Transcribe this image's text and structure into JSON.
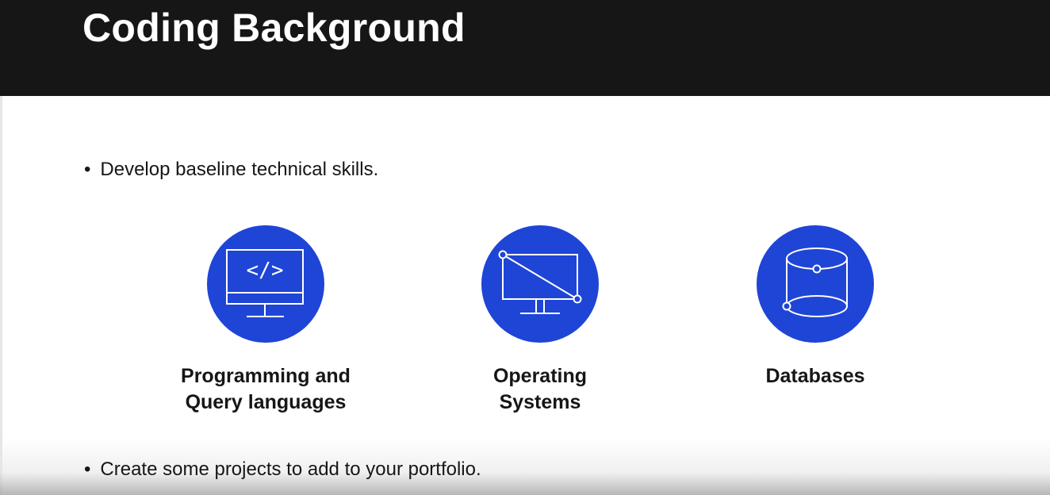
{
  "slide": {
    "title": "Coding Background",
    "bullets": [
      "Develop baseline technical skills.",
      "Create some projects to add to your portfolio."
    ],
    "bullet_symbol": "•",
    "items": [
      {
        "icon": "code-monitor-icon",
        "line1": "Programming and",
        "line2": "Query languages"
      },
      {
        "icon": "monitor-diagonal-icon",
        "line1": "Operating",
        "line2": "Systems"
      },
      {
        "icon": "database-cylinder-icon",
        "line1": "Databases",
        "line2": ""
      }
    ],
    "code_glyph": "</>"
  },
  "colors": {
    "header_bg": "#161616",
    "icon_circle": "#1f45d6",
    "text": "#161616",
    "title_text": "#ffffff"
  }
}
